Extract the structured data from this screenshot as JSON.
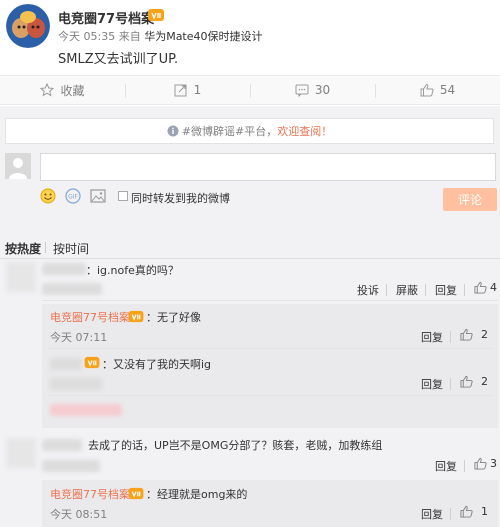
{
  "post": {
    "author": "电竞圈77号档案",
    "time": "今天 05:35",
    "from_label": "来自",
    "device": "华为Mate40保时捷设计",
    "content": "SMLZ又去试训了UP."
  },
  "actions": {
    "collect": "收藏",
    "repost_count": "1",
    "comment_count": "30",
    "like_count": "54"
  },
  "comment_panel": {
    "notice_prefix": "#微博辟谣#平台，",
    "notice_link": "欢迎查阅！",
    "repost_label": "同时转发到我的微博",
    "submit_label": "评论",
    "sort_hot": "按热度",
    "sort_time": "按时间"
  },
  "comments": [
    {
      "text": "：ig.nofe真的吗？",
      "report": "投诉",
      "block": "屏蔽",
      "reply": "回复",
      "likes": "4"
    },
    {
      "user": "电竞圈77号档案",
      "text": "：无了好像",
      "time": "今天 07:11",
      "reply": "回复",
      "likes": "2"
    },
    {
      "text": "：又没有了我的天啊ig",
      "reply": "回复",
      "likes": "2"
    },
    {
      "text": "去成了的话，UP岂不是OMG分部了？赅套，老贼，加教练组",
      "reply": "回复",
      "likes": "3"
    },
    {
      "user": "电竞圈77号档案",
      "text": "：经理就是omg来的",
      "time": "今天 08:51",
      "reply": "回复",
      "likes": "1"
    }
  ],
  "colors": {
    "accent": "#eb7350",
    "submit_bg": "#ffc09f",
    "panel_bg": "#f2f2f5"
  }
}
